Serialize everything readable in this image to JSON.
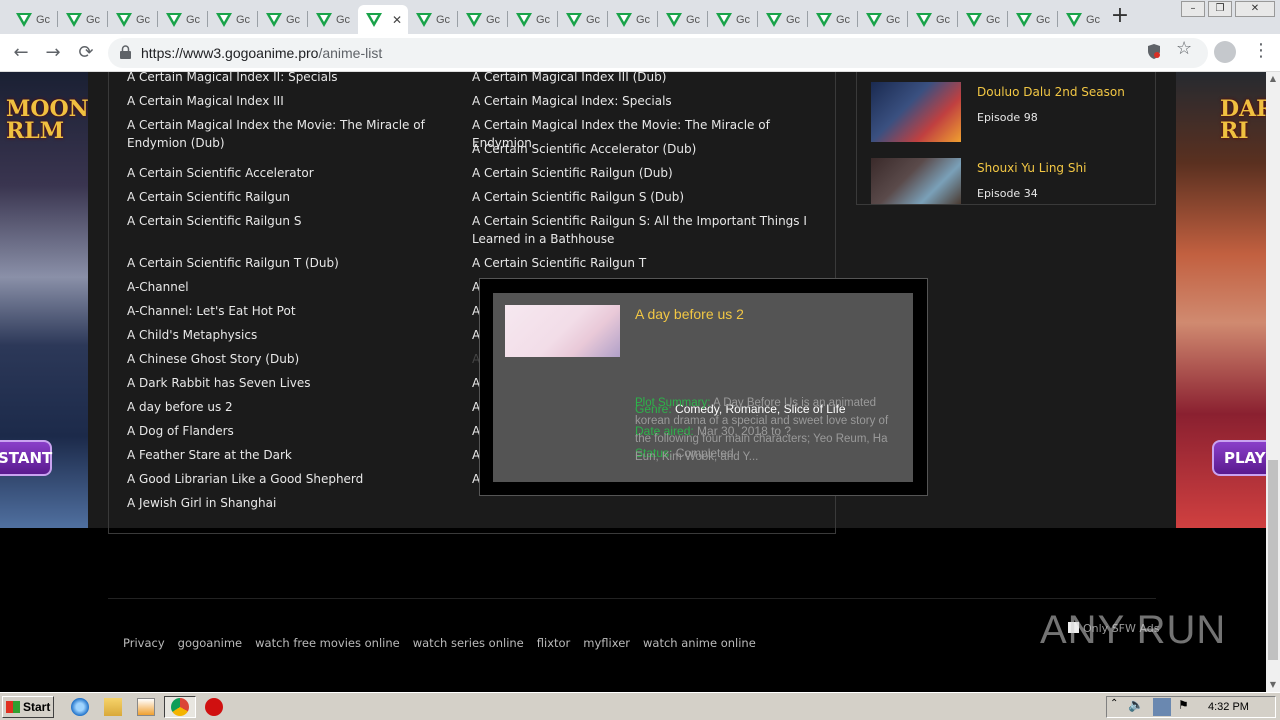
{
  "browser": {
    "tab_label": "Gc",
    "new_tab": "+",
    "url_host": "https://www3.gogoanime.pro",
    "url_path": "/anime-list",
    "window_minimize": "–",
    "window_restore": "❐",
    "window_close": "✕"
  },
  "anime_list": {
    "left": [
      "A Certain Magical Index II: Specials",
      "A Certain Magical Index III",
      "A Certain Magical Index the Movie: The Miracle of Endymion (Dub)",
      "A Certain Scientific Accelerator",
      "A Certain Scientific Railgun",
      "A Certain Scientific Railgun S",
      "A Certain Scientific Railgun T (Dub)",
      "A-Channel",
      "A-Channel: Let's Eat Hot Pot",
      "A Child's Metaphysics",
      "A Chinese Ghost Story (Dub)",
      "A Dark Rabbit has Seven Lives",
      "A day before us 2",
      "A Dog of Flanders",
      "A Feather Stare at the Dark",
      "A Good Librarian Like a Good Shepherd",
      "A Jewish Girl in Shanghai"
    ],
    "right": [
      "A Certain Magical Index III (Dub)",
      "A Certain Magical Index: Specials",
      "A Certain Magical Index the Movie: The Miracle of Endymion",
      "A Certain Scientific Accelerator (Dub)",
      "A Certain Scientific Railgun (Dub)",
      "A Certain Scientific Railgun S (Dub)",
      "A Certain Scientific Railgun S: All the Important Things I Learned in a Bathhouse",
      "A Certain Scientific Railgun T",
      "A-Channel: +A-Channel",
      "A-Channel+smile",
      "A Chinese Ghost Story",
      "A Clerk in Charge",
      "A",
      "A",
      "A",
      "A",
      "A"
    ]
  },
  "recent": [
    {
      "title": "Douluo Dalu 2nd Season",
      "episode": "Episode 98"
    },
    {
      "title": "Shouxi Yu Ling Shi",
      "episode": "Episode 34"
    }
  ],
  "popup": {
    "title": "A day before us 2",
    "genre_label": "Genre:",
    "genres": [
      "Comedy",
      "Romance",
      "Slice of Life"
    ],
    "date_label": "Date aired:",
    "date_value": "Mar 30, 2018 to ?",
    "status_label": "Status:",
    "status_value": "Completed",
    "summary_label": "Plot Summary:",
    "summary_text": "A Day Before Us is an animated korean drama of a special and sweet love story of the following four main characters; Yeo Reum, Ha Eun, Kim Wook, and Y..."
  },
  "ads": {
    "left_logo": "MOON\nRLM",
    "left_button": "STANT",
    "right_logo": "DAR\nRI",
    "right_button": "PLAY"
  },
  "footer": {
    "links": [
      "Privacy",
      "gogoanime",
      "watch free movies online",
      "watch series online",
      "flixtor",
      "myflixer",
      "watch anime online"
    ],
    "only_sfw": "Only SFW Ads"
  },
  "watermark": "ANY RUN",
  "taskbar": {
    "start": "Start",
    "clock": "4:32 PM"
  },
  "colors": {
    "accent_title": "#f2c744",
    "label_green": "#2db34a"
  }
}
